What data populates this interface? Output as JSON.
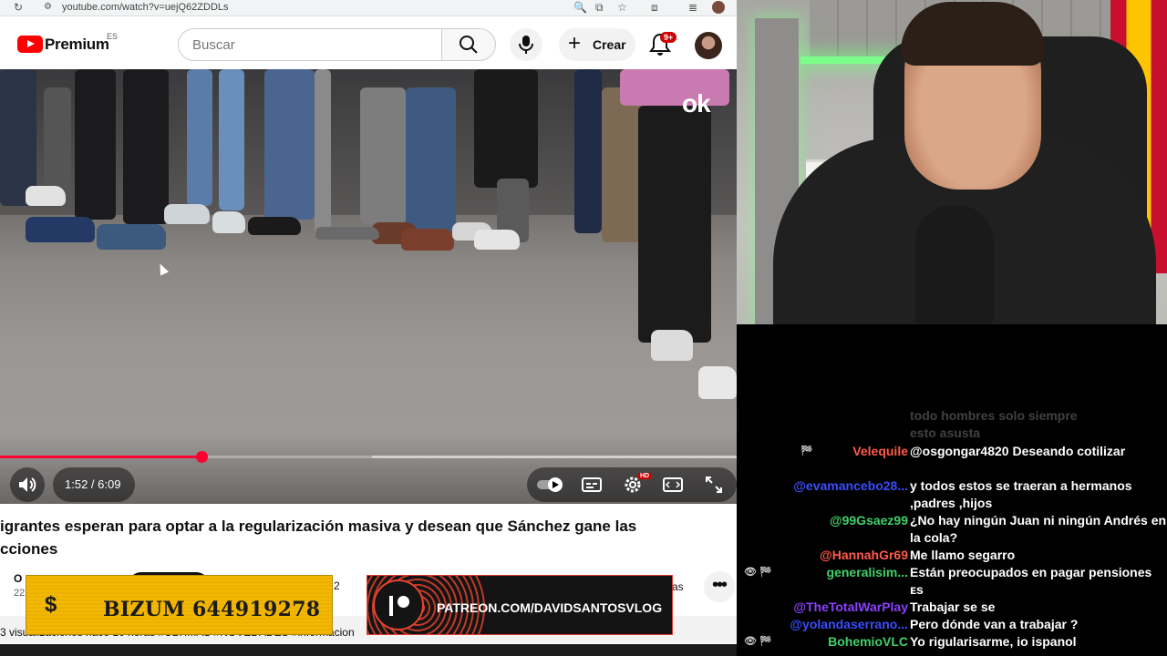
{
  "browser": {
    "url": "youtube.com/watch?v=uejQ62ZDDLs"
  },
  "header": {
    "logo_text": "Premium",
    "country_code": "ES",
    "search_placeholder": "Buscar",
    "create_label": "Crear",
    "notifications_badge": "9+"
  },
  "player": {
    "watermark": "ok",
    "current_time": "1:52",
    "duration": "6:09",
    "time_display": "1:52 / 6:09",
    "progress_fraction": 0.273,
    "hd_badge": "HD"
  },
  "video": {
    "title_line1": "igrantes esperan para optar a la regularización masiva y desean que Sánchez gane las",
    "title_line2": "cciones",
    "channel_initial": "O",
    "date_partial": "22",
    "likes_partial": "2",
    "share_partial": "as",
    "description_partial": "3 visualizaciones hace 10 horas  #ULTIMAS #NOVEDADES #informacion"
  },
  "overlays": {
    "bizum_symbol": "$",
    "bizum_text": "BIZUM 644919278",
    "patreon_text": "PATREON.COM/DAVIDSANTOSVLOG"
  },
  "chat": {
    "messages": [
      {
        "user": "",
        "text": "todo hombres solo siempre",
        "user_color": "#888888",
        "faded": true
      },
      {
        "user": "",
        "text": "esto asusta",
        "user_color": "#888888",
        "faded": true
      },
      {
        "user": "Velequile",
        "text": "@osgongar4820 Deseando cotilizar",
        "user_color": "#ff5a4a",
        "badges": "🏁"
      },
      {
        "user": "@evamancebo28...",
        "text": "y todos estos se traeran a hermanos ,padres ,hijos",
        "user_color": "#3a4dff"
      },
      {
        "user": "@99Gsaez99",
        "text": "¿No hay ningún Juan ni ningún Andrés en la cola?",
        "user_color": "#3fd16a"
      },
      {
        "user": "@HannahGr69",
        "text": "Me llamo segarro",
        "user_color": "#ff5a4a"
      },
      {
        "user": "generalisim...",
        "text": "Están preocupados en pagar pensiones ᴇs",
        "user_color": "#3fd16a",
        "badges": "👁 🏁"
      },
      {
        "user": "@TheTotalWarPlay",
        "text": "Trabajar se se",
        "user_color": "#8a3fff"
      },
      {
        "user": "@yolandaserrano...",
        "text": "Pero dónde van a trabajar ?",
        "user_color": "#3a4dff"
      },
      {
        "user": "BohemioVLC",
        "text": "Yo rigularisarme, io ispanol",
        "user_color": "#3fd16a",
        "badges": "👁 🏁"
      }
    ]
  },
  "colors": {
    "youtube_red": "#ff0000",
    "progress_red": "#ff0033",
    "bizum_yellow": "#f5b800",
    "patreon_orange": "#e8432f"
  }
}
